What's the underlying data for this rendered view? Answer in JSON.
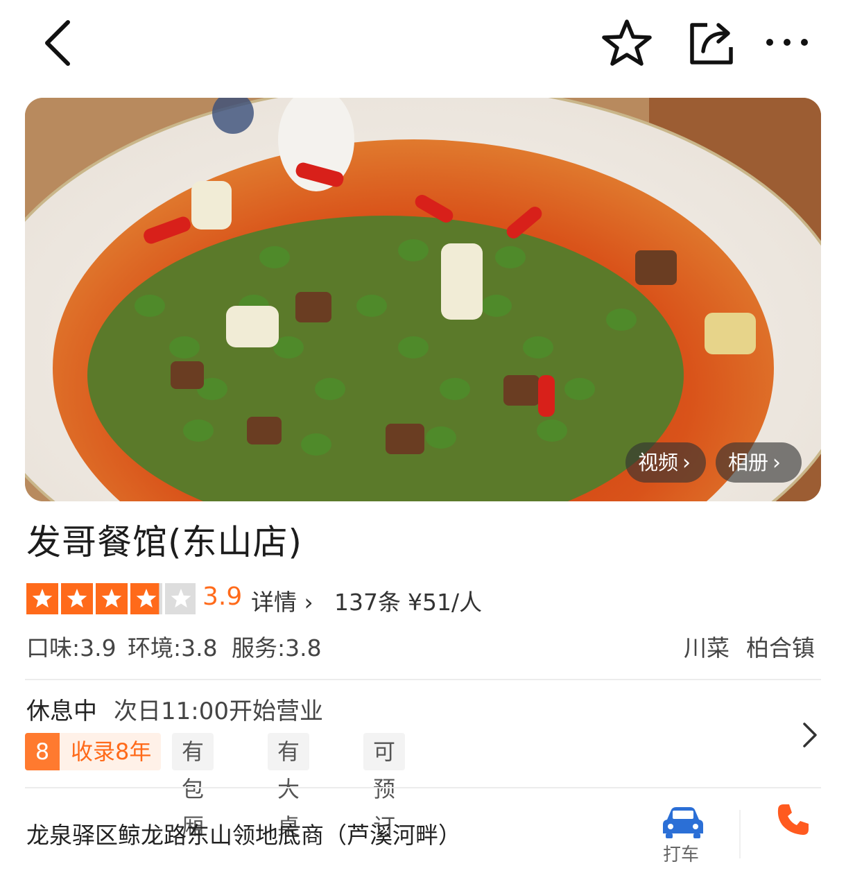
{
  "nav": {
    "back_icon": "chevron-left-icon",
    "favorite_icon": "star-outline-icon",
    "share_icon": "share-icon",
    "more_icon": "more-dots-icon"
  },
  "hero": {
    "video_label": "视频",
    "album_label": "相册"
  },
  "restaurant": {
    "name": "发哥餐馆(东山店)",
    "rating": 3.9,
    "rating_text": "3.9",
    "detail_label": "详情",
    "reviews": "137条",
    "price": "¥51/人",
    "scores": {
      "taste": "口味:3.9",
      "environment": "环境:3.8",
      "service": "服务:3.8"
    },
    "cuisine": "川菜",
    "area": "柏合镇"
  },
  "hours": {
    "status": "休息中",
    "next_open": "次日11:00开始营业"
  },
  "tags": {
    "years_number": "8",
    "years_label": "收录8年",
    "items": [
      "有包厢",
      "有大桌",
      "可预订"
    ]
  },
  "location": {
    "address": "龙泉驿区鲸龙路东山领地底商（芦溪河畔）",
    "taxi_label": "打车"
  },
  "colors": {
    "accent": "#ff6a1a",
    "star_on": "#ff6a1a",
    "star_off": "#dddddd",
    "taxi_icon": "#2b6fd6",
    "phone_icon": "#ff5a1f"
  }
}
